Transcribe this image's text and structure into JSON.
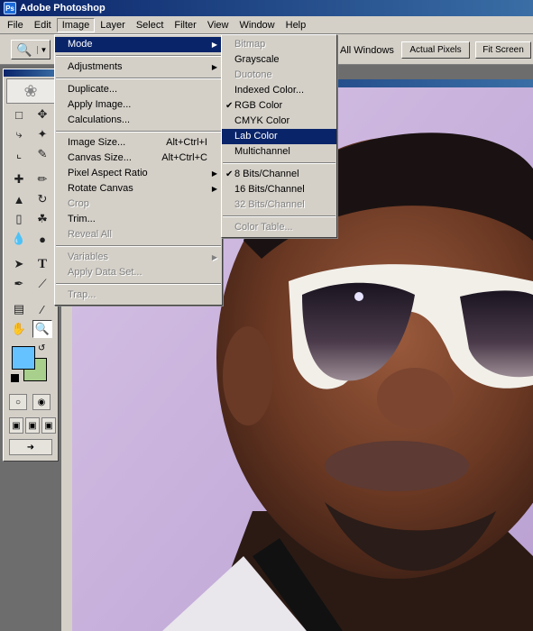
{
  "app": {
    "title": "Adobe Photoshop",
    "icon": "photoshop-app-icon"
  },
  "menubar": {
    "items": [
      "File",
      "Edit",
      "Image",
      "Layer",
      "Select",
      "Filter",
      "View",
      "Window",
      "Help"
    ],
    "active": "Image"
  },
  "options_bar": {
    "tool_icon": "zoom-icon",
    "label": "All Windows",
    "buttons": [
      "Actual Pixels",
      "Fit Screen"
    ]
  },
  "image_menu": {
    "items": [
      {
        "label": "Mode",
        "submenu": true,
        "highlighted": true
      },
      {
        "separator": true
      },
      {
        "label": "Adjustments",
        "submenu": true
      },
      {
        "separator": true
      },
      {
        "label": "Duplicate..."
      },
      {
        "label": "Apply Image..."
      },
      {
        "label": "Calculations..."
      },
      {
        "separator": true
      },
      {
        "label": "Image Size...",
        "shortcut": "Alt+Ctrl+I"
      },
      {
        "label": "Canvas Size...",
        "shortcut": "Alt+Ctrl+C"
      },
      {
        "label": "Pixel Aspect Ratio",
        "submenu": true
      },
      {
        "label": "Rotate Canvas",
        "submenu": true
      },
      {
        "label": "Crop",
        "disabled": true
      },
      {
        "label": "Trim..."
      },
      {
        "label": "Reveal All",
        "disabled": true
      },
      {
        "separator": true
      },
      {
        "label": "Variables",
        "submenu": true,
        "disabled": true
      },
      {
        "label": "Apply Data Set...",
        "disabled": true
      },
      {
        "separator": true
      },
      {
        "label": "Trap...",
        "disabled": true
      }
    ]
  },
  "mode_submenu": {
    "items": [
      {
        "label": "Bitmap",
        "disabled": true
      },
      {
        "label": "Grayscale"
      },
      {
        "label": "Duotone",
        "disabled": true
      },
      {
        "label": "Indexed Color..."
      },
      {
        "label": "RGB Color",
        "checked": true
      },
      {
        "label": "CMYK Color"
      },
      {
        "label": "Lab Color",
        "highlighted": true
      },
      {
        "label": "Multichannel"
      },
      {
        "separator": true
      },
      {
        "label": "8 Bits/Channel",
        "checked": true
      },
      {
        "label": "16 Bits/Channel"
      },
      {
        "label": "32 Bits/Channel",
        "disabled": true
      },
      {
        "separator": true
      },
      {
        "label": "Color Table...",
        "disabled": true
      }
    ]
  },
  "toolbox": {
    "foreground_color": "#66c2ff",
    "background_color": "#a8d08c",
    "tools": [
      "marquee-icon",
      "move-icon",
      "lasso-icon",
      "magic-wand-icon",
      "crop-icon",
      "slice-icon",
      "healing-brush-icon",
      "brush-icon",
      "clone-stamp-icon",
      "history-brush-icon",
      "eraser-icon",
      "paint-bucket-icon",
      "blur-icon",
      "dodge-icon",
      "path-selection-icon",
      "type-icon",
      "pen-icon",
      "line-icon",
      "notes-icon",
      "eyedropper-icon",
      "hand-icon",
      "zoom-icon"
    ],
    "selected_tool": "zoom-icon"
  },
  "colors": {
    "menu_highlight": "#0a246a",
    "titlebar": "#0a246a",
    "chrome": "#d4d0c8"
  }
}
